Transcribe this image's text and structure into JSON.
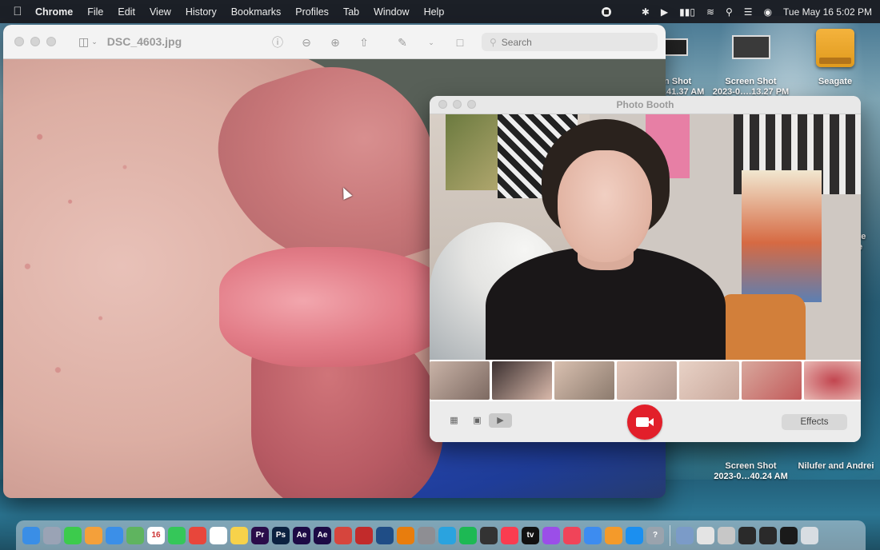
{
  "menubar": {
    "app_name": "Chrome",
    "items": [
      "File",
      "Edit",
      "View",
      "History",
      "Bookmarks",
      "Profiles",
      "Tab",
      "Window",
      "Help"
    ],
    "clock": "Tue May 16  5:02 PM"
  },
  "desktop": {
    "items": [
      {
        "label_line1": "n Shot",
        "label_line2": ".41.37 AM"
      },
      {
        "label_line1": "Screen Shot",
        "label_line2": "2023-0….13.27 PM"
      },
      {
        "label_line1": "Seagate",
        "label_line2": ""
      },
      {
        "label_line1": "re",
        "label_line2": "e"
      },
      {
        "label_line1": "Screen Shot",
        "label_line2": "2023-0…40.24 AM"
      },
      {
        "label_line1": "Nilufer and Andrei",
        "label_line2": ""
      }
    ]
  },
  "preview": {
    "title": "DSC_4603.jpg",
    "search_placeholder": "Search"
  },
  "photobooth": {
    "title": "Photo Booth",
    "effects_label": "Effects",
    "thumb_count": 7
  },
  "dock": {
    "icons": [
      {
        "name": "finder",
        "color": "#3a8ee6",
        "glyph": ""
      },
      {
        "name": "launchpad",
        "color": "#9aa3b5",
        "glyph": ""
      },
      {
        "name": "messages",
        "color": "#3ccb4c",
        "glyph": ""
      },
      {
        "name": "photos",
        "color": "#f4a03a",
        "glyph": ""
      },
      {
        "name": "mail",
        "color": "#3b8fe8",
        "glyph": ""
      },
      {
        "name": "maps",
        "color": "#5fb45f",
        "glyph": ""
      },
      {
        "name": "calendar",
        "color": "#ffffff",
        "glyph": "16"
      },
      {
        "name": "facetime",
        "color": "#35c759",
        "glyph": ""
      },
      {
        "name": "chrome",
        "color": "#e8463b",
        "glyph": ""
      },
      {
        "name": "reminders",
        "color": "#ffffff",
        "glyph": ""
      },
      {
        "name": "notes",
        "color": "#f7d24a",
        "glyph": ""
      },
      {
        "name": "premiere",
        "color": "#2a0c4a",
        "glyph": "Pr"
      },
      {
        "name": "photoshop",
        "color": "#0b2140",
        "glyph": "Ps"
      },
      {
        "name": "after-effects",
        "color": "#1d0a45",
        "glyph": "Ae"
      },
      {
        "name": "after-effects-2",
        "color": "#1d0a45",
        "glyph": "Ae"
      },
      {
        "name": "app-red",
        "color": "#d6453d",
        "glyph": ""
      },
      {
        "name": "app-red-2",
        "color": "#c22b2b",
        "glyph": ""
      },
      {
        "name": "quicktime",
        "color": "#1f4d86",
        "glyph": ""
      },
      {
        "name": "blender",
        "color": "#e87d0d",
        "glyph": ""
      },
      {
        "name": "settings",
        "color": "#8e8e93",
        "glyph": ""
      },
      {
        "name": "telegram",
        "color": "#2aa3df",
        "glyph": ""
      },
      {
        "name": "spotify",
        "color": "#1db954",
        "glyph": ""
      },
      {
        "name": "terminal-mini",
        "color": "#333333",
        "glyph": ""
      },
      {
        "name": "music",
        "color": "#fa3c50",
        "glyph": ""
      },
      {
        "name": "tv",
        "color": "#111111",
        "glyph": "tv"
      },
      {
        "name": "podcasts",
        "color": "#9b4ee8",
        "glyph": ""
      },
      {
        "name": "news",
        "color": "#f04459",
        "glyph": ""
      },
      {
        "name": "keynote",
        "color": "#3d8cf0",
        "glyph": ""
      },
      {
        "name": "pages",
        "color": "#f49a2a",
        "glyph": ""
      },
      {
        "name": "app-store",
        "color": "#1b8ff0",
        "glyph": ""
      },
      {
        "name": "help",
        "color": "#9aa3ad",
        "glyph": "?"
      },
      {
        "name": "separator",
        "color": "",
        "glyph": ""
      },
      {
        "name": "preview",
        "color": "#7b9bc8",
        "glyph": ""
      },
      {
        "name": "printer",
        "color": "#e4e4e4",
        "glyph": ""
      },
      {
        "name": "font-book",
        "color": "#c7c7c7",
        "glyph": ""
      },
      {
        "name": "window-1",
        "color": "#2a2a2a",
        "glyph": ""
      },
      {
        "name": "window-2",
        "color": "#2a2a2a",
        "glyph": ""
      },
      {
        "name": "window-3",
        "color": "#1a1a1a",
        "glyph": ""
      },
      {
        "name": "trash",
        "color": "#d8dde2",
        "glyph": ""
      }
    ]
  }
}
